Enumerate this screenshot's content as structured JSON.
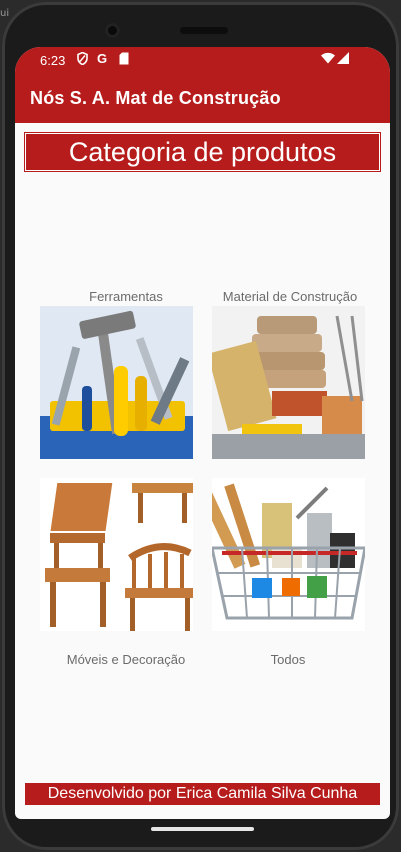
{
  "status": {
    "time": "6:23",
    "icons": [
      "shield-icon",
      "google-g-icon",
      "sd-card-icon",
      "wifi-icon",
      "signal-icon"
    ]
  },
  "appbar": {
    "title": "Nós S. A. Mat de Construção"
  },
  "header": {
    "title": "Categoria de produtos"
  },
  "categories": [
    {
      "label": "Ferramentas",
      "icon": "tools-image"
    },
    {
      "label": "Material de Construção",
      "icon": "construction-material-image"
    },
    {
      "label": "Móveis e Decoração",
      "icon": "furniture-image"
    },
    {
      "label": "Todos",
      "icon": "shopping-basket-image"
    }
  ],
  "footer": {
    "credit": "Desenvolvido por Erica Camila Silva Cunha"
  },
  "corner": {
    "text": "ui"
  },
  "colors": {
    "primary": "#b71c1c",
    "background": "#fafafa",
    "label_text": "#6b6b6b"
  }
}
